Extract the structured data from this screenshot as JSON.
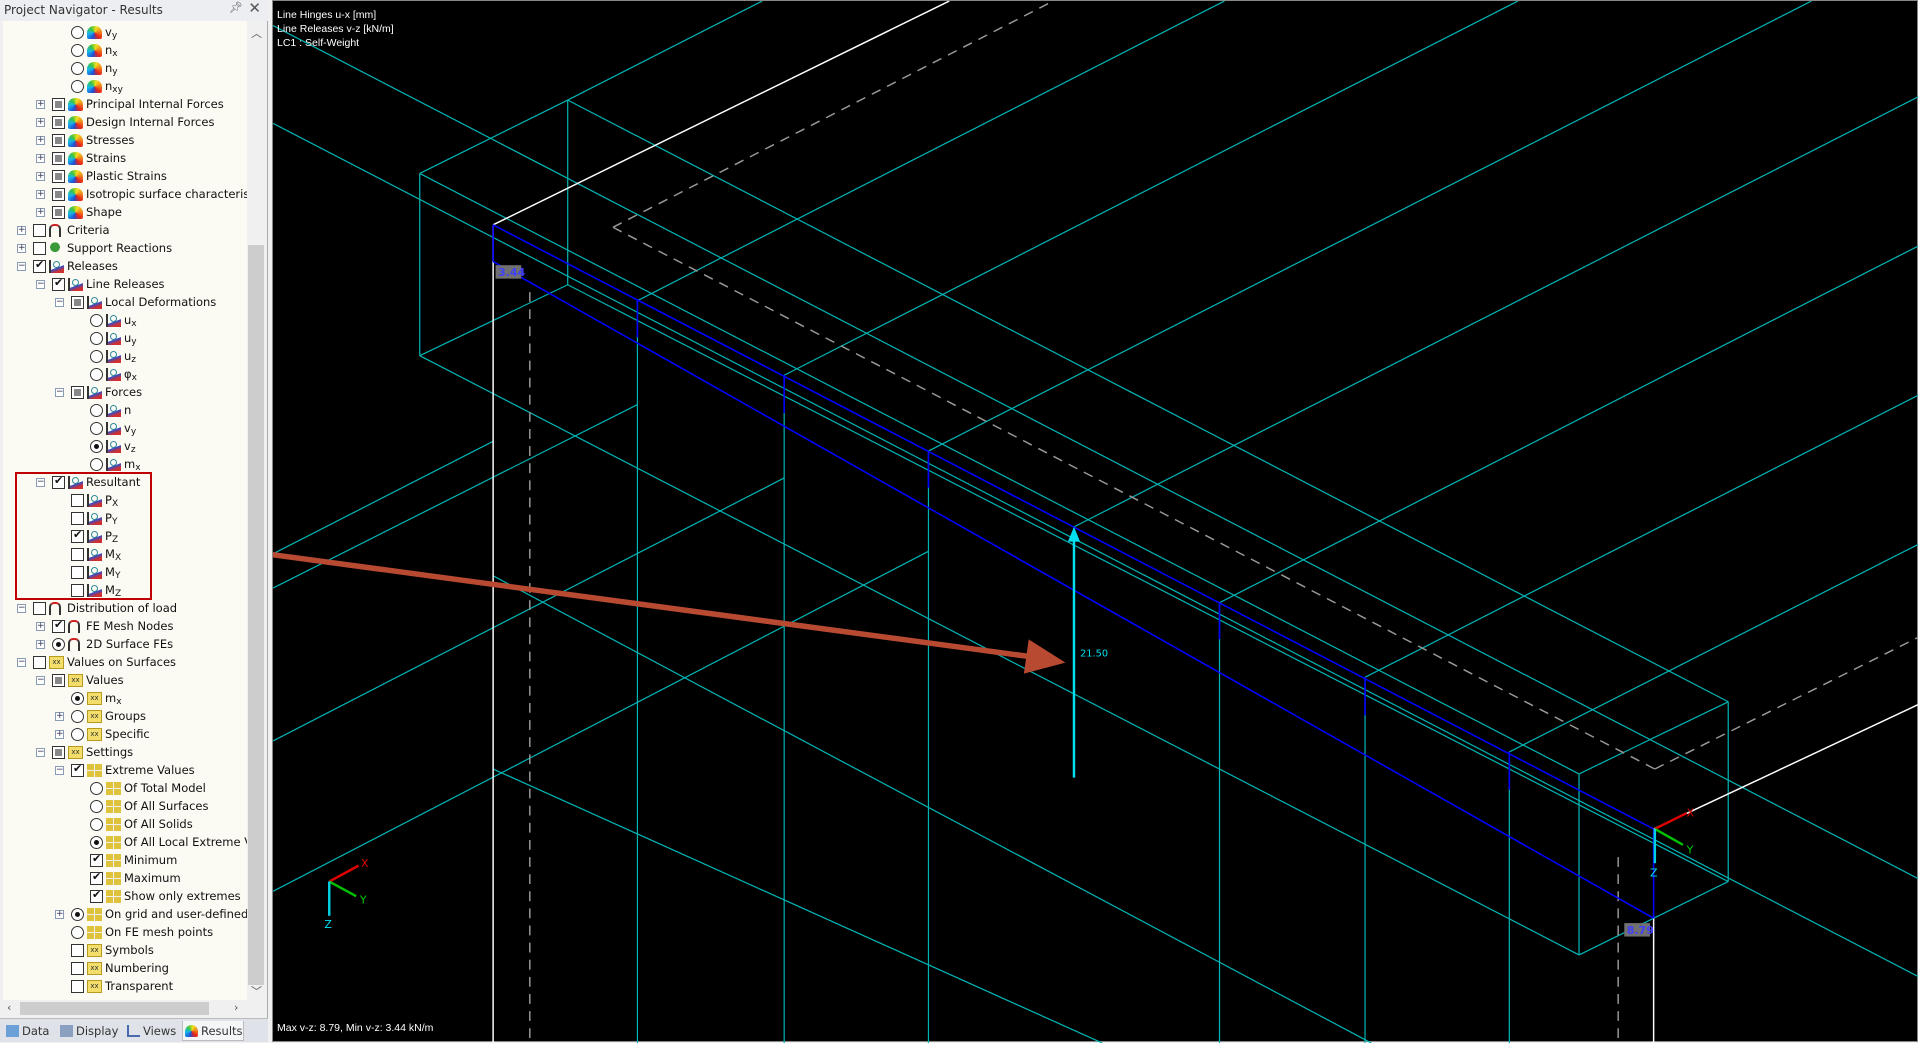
{
  "navigator": {
    "title": "Project Navigator - Results",
    "tree": [
      {
        "level": 2,
        "ctl": "r0",
        "icon": "rainbow",
        "label": "v",
        "sub": "y"
      },
      {
        "level": 2,
        "ctl": "r0",
        "icon": "rainbow",
        "label": "n",
        "sub": "x"
      },
      {
        "level": 2,
        "ctl": "r0",
        "icon": "rainbow",
        "label": "n",
        "sub": "y"
      },
      {
        "level": 2,
        "ctl": "r0",
        "icon": "rainbow",
        "label": "n",
        "sub": "xy"
      },
      {
        "level": 1,
        "ctl": "p",
        "icon": "rainbow",
        "label": "Principal Internal Forces",
        "exp": "+"
      },
      {
        "level": 1,
        "ctl": "p",
        "icon": "rainbow",
        "label": "Design Internal Forces",
        "exp": "+"
      },
      {
        "level": 1,
        "ctl": "p",
        "icon": "rainbow",
        "label": "Stresses",
        "exp": "+"
      },
      {
        "level": 1,
        "ctl": "p",
        "icon": "rainbow",
        "label": "Strains",
        "exp": "+"
      },
      {
        "level": 1,
        "ctl": "p",
        "icon": "rainbow",
        "label": "Plastic Strains",
        "exp": "+"
      },
      {
        "level": 1,
        "ctl": "p",
        "icon": "rainbow",
        "label": "Isotropic surface characteristics",
        "exp": "+"
      },
      {
        "level": 1,
        "ctl": "p",
        "icon": "rainbow",
        "label": "Shape",
        "exp": "+"
      },
      {
        "level": 0,
        "ctl": "u",
        "icon": "criteria",
        "label": "Criteria",
        "exp": "+"
      },
      {
        "level": 0,
        "ctl": "u",
        "icon": "support",
        "label": "Support Reactions",
        "exp": "+"
      },
      {
        "level": 0,
        "ctl": "c",
        "icon": "release",
        "label": "Releases",
        "exp": "-"
      },
      {
        "level": 1,
        "ctl": "c",
        "icon": "release",
        "label": "Line Releases",
        "exp": "-"
      },
      {
        "level": 2,
        "ctl": "p",
        "icon": "release",
        "label": "Local Deformations",
        "exp": "-"
      },
      {
        "level": 3,
        "ctl": "r0",
        "icon": "release",
        "label": "u",
        "sub": "x"
      },
      {
        "level": 3,
        "ctl": "r0",
        "icon": "release",
        "label": "u",
        "sub": "y"
      },
      {
        "level": 3,
        "ctl": "r0",
        "icon": "release",
        "label": "u",
        "sub": "z"
      },
      {
        "level": 3,
        "ctl": "r0",
        "icon": "release",
        "label": "φ",
        "sub": "x"
      },
      {
        "level": 2,
        "ctl": "p",
        "icon": "release",
        "label": "Forces",
        "exp": "-"
      },
      {
        "level": 3,
        "ctl": "r0",
        "icon": "release",
        "label": "n"
      },
      {
        "level": 3,
        "ctl": "r0",
        "icon": "release",
        "label": "v",
        "sub": "y"
      },
      {
        "level": 3,
        "ctl": "r1",
        "icon": "release",
        "label": "v",
        "sub": "z"
      },
      {
        "level": 3,
        "ctl": "r0",
        "icon": "release",
        "label": "m",
        "sub": "x"
      },
      {
        "level": 1,
        "ctl": "c",
        "icon": "release",
        "label": "Resultant",
        "exp": "-"
      },
      {
        "level": 2,
        "ctl": "u",
        "icon": "release",
        "label": "P",
        "sub": "X"
      },
      {
        "level": 2,
        "ctl": "u",
        "icon": "release",
        "label": "P",
        "sub": "Y"
      },
      {
        "level": 2,
        "ctl": "c",
        "icon": "release",
        "label": "P",
        "sub": "Z"
      },
      {
        "level": 2,
        "ctl": "u",
        "icon": "release",
        "label": "M",
        "sub": "X"
      },
      {
        "level": 2,
        "ctl": "u",
        "icon": "release",
        "label": "M",
        "sub": "Y"
      },
      {
        "level": 2,
        "ctl": "u",
        "icon": "release",
        "label": "M",
        "sub": "Z"
      },
      {
        "level": 0,
        "ctl": "u",
        "icon": "criteria",
        "label": "Distribution of load",
        "exp": "-"
      },
      {
        "level": 1,
        "ctl": "c",
        "icon": "criteria",
        "label": "FE Mesh Nodes",
        "exp": "+"
      },
      {
        "level": 1,
        "ctl": "r1",
        "icon": "criteria",
        "label": "2D Surface FEs",
        "exp": "+"
      },
      {
        "level": 0,
        "ctl": "u",
        "icon": "xx",
        "label": "Values on Surfaces",
        "exp": "-"
      },
      {
        "level": 1,
        "ctl": "p",
        "icon": "xx",
        "label": "Values",
        "exp": "-"
      },
      {
        "level": 2,
        "ctl": "r1",
        "icon": "xx",
        "label": "m",
        "sub": "x"
      },
      {
        "level": 2,
        "ctl": "r0",
        "icon": "xx",
        "label": "Groups",
        "exp": "+"
      },
      {
        "level": 2,
        "ctl": "r0",
        "icon": "xx",
        "label": "Specific",
        "exp": "+"
      },
      {
        "level": 1,
        "ctl": "p",
        "icon": "xx",
        "label": "Settings",
        "exp": "-"
      },
      {
        "level": 2,
        "ctl": "c",
        "icon": "grid",
        "label": "Extreme Values",
        "exp": "-"
      },
      {
        "level": 3,
        "ctl": "r0",
        "icon": "grid",
        "label": "Of Total Model"
      },
      {
        "level": 3,
        "ctl": "r0",
        "icon": "grid",
        "label": "Of All Surfaces"
      },
      {
        "level": 3,
        "ctl": "r0",
        "icon": "grid",
        "label": "Of All Solids"
      },
      {
        "level": 3,
        "ctl": "r1",
        "icon": "grid",
        "label": "Of All Local Extreme Val"
      },
      {
        "level": 3,
        "ctl": "c",
        "icon": "grid",
        "label": "Minimum"
      },
      {
        "level": 3,
        "ctl": "c",
        "icon": "grid",
        "label": "Maximum"
      },
      {
        "level": 3,
        "ctl": "c",
        "icon": "grid",
        "label": "Show only extremes"
      },
      {
        "level": 2,
        "ctl": "r1",
        "icon": "grid",
        "label": "On grid and user-defined p",
        "exp": "+"
      },
      {
        "level": 2,
        "ctl": "r0",
        "icon": "grid",
        "label": "On FE mesh points"
      },
      {
        "level": 2,
        "ctl": "u",
        "icon": "xx",
        "label": "Symbols"
      },
      {
        "level": 2,
        "ctl": "u",
        "icon": "xx",
        "label": "Numbering"
      },
      {
        "level": 2,
        "ctl": "u",
        "icon": "xx",
        "label": "Transparent"
      }
    ],
    "tabs": [
      "Data",
      "Display",
      "Views",
      "Results"
    ],
    "active_tab": "Results"
  },
  "viewport": {
    "header": [
      "Line Hinges u-x [mm]",
      "Line Releases v-z [kN/m]",
      "LC1 : Self-Weight"
    ],
    "labels": {
      "min_value": "3.44",
      "max_value": "8.79",
      "resultant_value": "21.50"
    },
    "axes": {
      "x": "X",
      "y": "Y",
      "z": "Z"
    },
    "footer": "Max v-z: 8.79, Min v-z: 3.44 kN/m",
    "colors": {
      "background": "#000000",
      "mesh": "#00b4b4",
      "line_release": "#0000ff",
      "resultant": "#00e0f0",
      "annotation_arrow": "#b84a32",
      "highlight_box": "#c00000"
    }
  }
}
